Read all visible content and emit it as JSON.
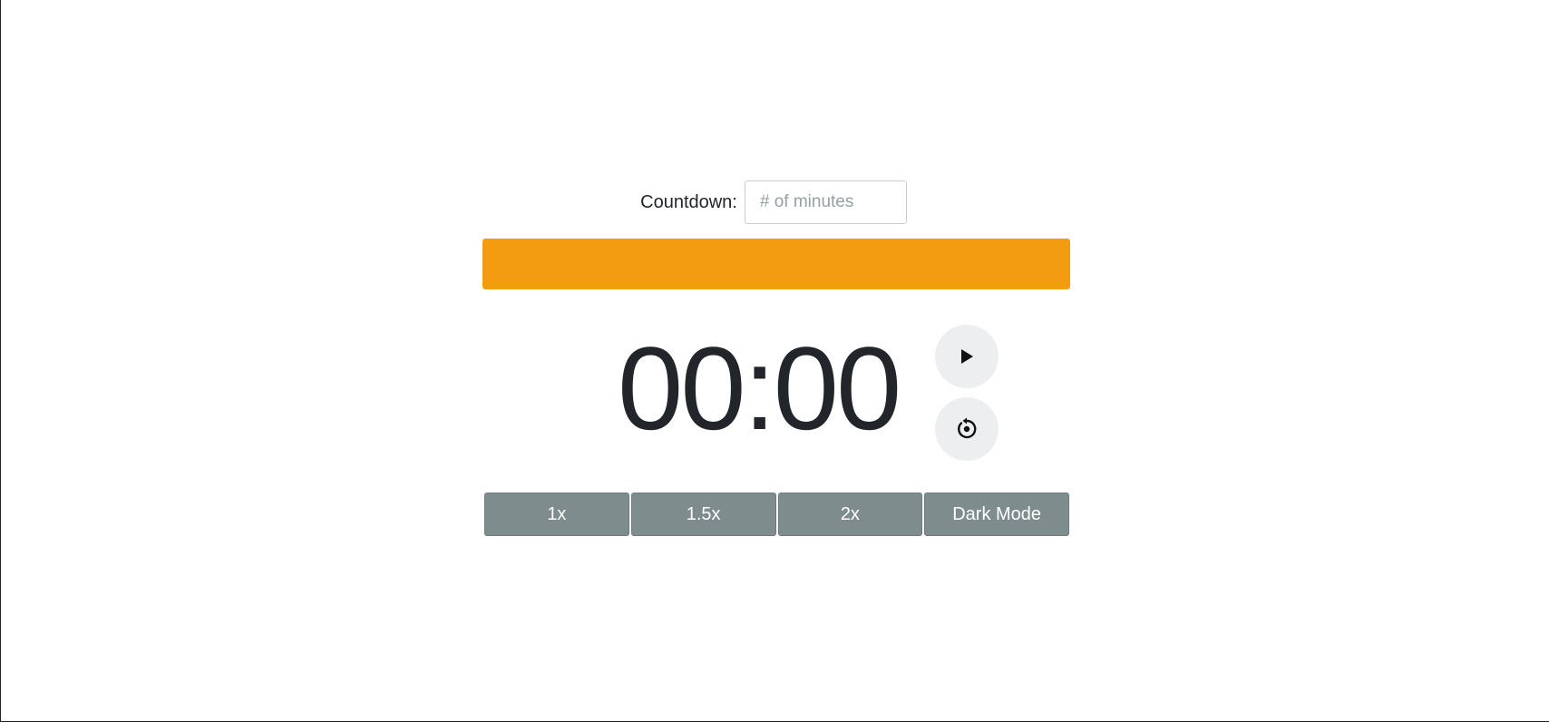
{
  "countdown": {
    "label": "Countdown:",
    "input_placeholder": "# of minutes",
    "input_value": ""
  },
  "progress": {
    "percent": 100,
    "color": "#f39c12"
  },
  "timer": {
    "display": "00:00"
  },
  "controls": {
    "play_icon": "play-icon",
    "reset_icon": "reset-icon"
  },
  "speed_buttons": [
    {
      "label": "1x"
    },
    {
      "label": "1.5x"
    },
    {
      "label": "2x"
    },
    {
      "label": "Dark Mode"
    }
  ],
  "colors": {
    "accent": "#f39c12",
    "button_gray": "#7f8c8d",
    "round_button_bg": "#eceeef",
    "text": "#212529"
  }
}
